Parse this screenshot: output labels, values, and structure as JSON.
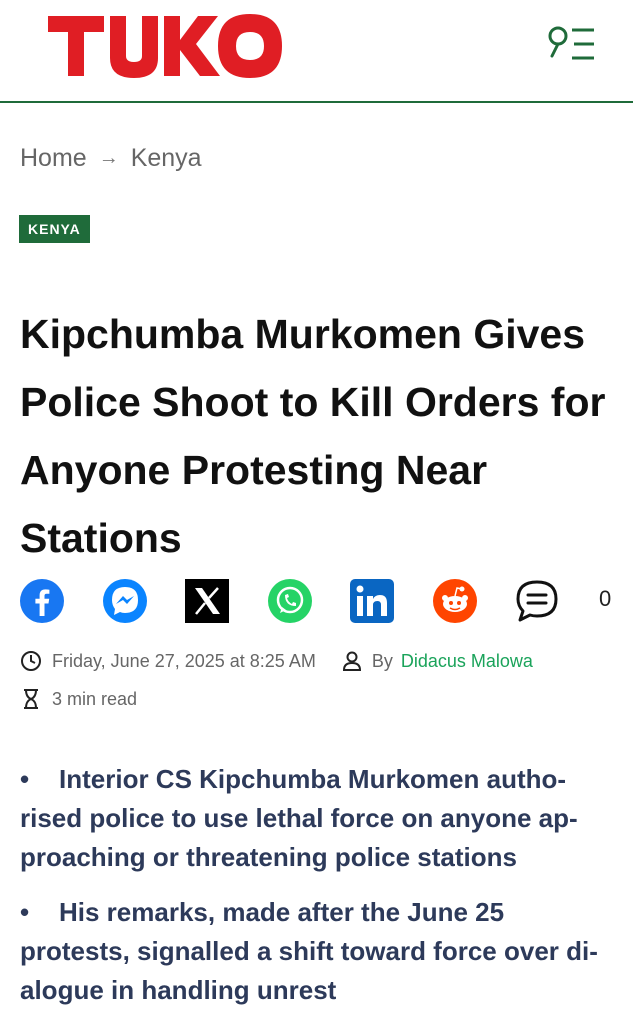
{
  "header": {
    "logo_text": "TUKO",
    "menu_icon": "search-menu-icon"
  },
  "breadcrumb": {
    "home": "Home",
    "separator": "→",
    "section": "Kenya"
  },
  "article": {
    "category_tag": "KENYA",
    "headline": "Kipchumba Murkomen Gives Police Shoot to Kill Orders for Anyone Protesting Near Stations",
    "share": {
      "icons": [
        "facebook-icon",
        "messenger-icon",
        "x-icon",
        "whatsapp-icon",
        "linkedin-icon",
        "reddit-icon",
        "comment-icon"
      ],
      "comment_count": "0"
    },
    "date": "Friday, June 27, 2025 at 8:25 AM",
    "by_label": "By",
    "author": "Didacus Malowa",
    "read_time": "3 min read",
    "bullet_char": "•",
    "bullets": [
      "Interior CS Kipchumba Murkomen autho-rised police to use lethal force on anyone ap-proaching or threatening police stations",
      "His remarks, made after the June 25 protests, signalled a shift toward force over di-alogue in handling unrest"
    ]
  },
  "colors": {
    "brand_red": "#e01e24",
    "brand_green": "#1f6b3a",
    "author_link": "#1aa35a",
    "bullet_text": "#2d3a5a"
  }
}
